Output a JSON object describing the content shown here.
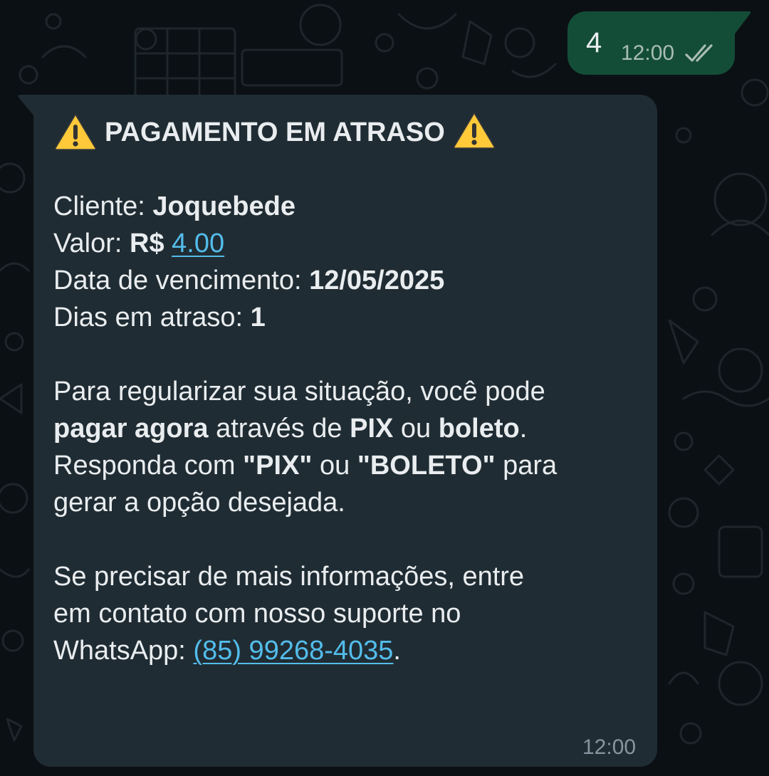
{
  "outgoing": {
    "text": "4",
    "time": "12:00",
    "status_icon": "double-check-icon"
  },
  "incoming": {
    "title": "PAGAMENTO EM ATRASO",
    "title_icon": "warning-icon",
    "client_label": "Cliente: ",
    "client_value": "Joquebede",
    "valor_label": "Valor: ",
    "valor_currency": "R$ ",
    "valor_value": "4.00",
    "due_label": "Data de vencimento: ",
    "due_value": "12/05/2025",
    "days_label": "Dias em atraso: ",
    "days_value": "1",
    "para_line1": "Para regularizar sua situação, você pode",
    "pagar_agora": "pagar agora",
    "atraves_de": " através de ",
    "pix": "PIX",
    "ou": " ou ",
    "boleto": "boleto",
    "period": ".",
    "responda": "Responda com ",
    "pix_quoted": "\"PIX\"",
    "ou2": " ou ",
    "boleto_quoted": "\"BOLETO\"",
    "para": " para",
    "gerar": "gerar a opção desejada.",
    "se_precisar": "Se precisar de mais informações, entre",
    "em_contato": "em contato com nosso suporte no",
    "whatsapp_label": "WhatsApp: ",
    "phone": "(85) 99268-4035",
    "phone_period": ".",
    "time": "12:00"
  },
  "colors": {
    "background": "#0b1014",
    "incoming_bubble": "#202c33",
    "outgoing_bubble": "#144d37",
    "link": "#53bdeb",
    "text": "#e9edef",
    "check": "#a8bdb3"
  }
}
